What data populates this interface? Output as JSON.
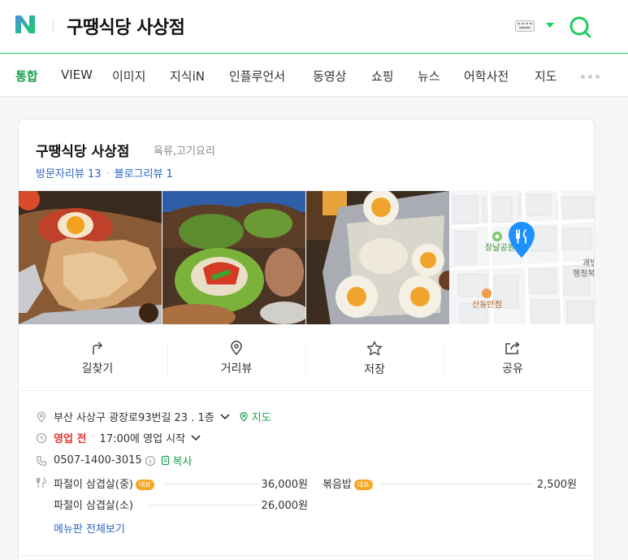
{
  "header": {
    "query": "구땡식당 사상점",
    "brand_color": "#19ce60"
  },
  "tabs": [
    {
      "label": "통합",
      "active": true
    },
    {
      "label": "VIEW"
    },
    {
      "label": "이미지"
    },
    {
      "label": "지식iN"
    },
    {
      "label": "인플루언서"
    },
    {
      "label": "동영상"
    },
    {
      "label": "쇼핑"
    },
    {
      "label": "뉴스"
    },
    {
      "label": "어학사전"
    },
    {
      "label": "지도"
    }
  ],
  "place": {
    "name": "구땡식당 사상점",
    "category": "육류,고기요리",
    "visitor_reviews": "방문자리뷰 13",
    "blog_reviews": "블로그리뷰 1"
  },
  "map": {
    "labels": [
      "창날공원",
      "산동반점",
      "괘법",
      "행정복"
    ]
  },
  "actions": {
    "directions": "길찾기",
    "street_view": "거리뷰",
    "save": "저장",
    "share": "공유"
  },
  "info": {
    "address": "부산 사상구 광장로93번길 23 . 1층",
    "map_link": "지도",
    "status": "영업 전",
    "hours": "17:00에 영업 시작",
    "phone": "0507-1400-3015",
    "copy": "복사"
  },
  "menu": {
    "items": [
      {
        "name": "파절이 삼겹살(중)",
        "badge": "대표",
        "price": "36,000원"
      },
      {
        "name": "볶음밥",
        "badge": "대표",
        "price": "2,500원"
      },
      {
        "name": "파절이 삼겹살(소)",
        "price": "26,000원"
      }
    ],
    "view_all": "메뉴판 전체보기"
  }
}
